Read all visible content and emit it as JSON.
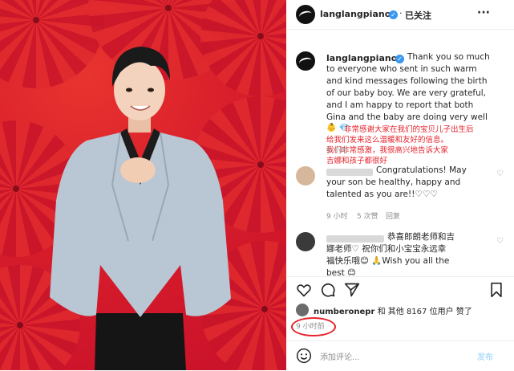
{
  "header": {
    "username": "langlangpiano",
    "follow_status": "已关注",
    "more": "···"
  },
  "caption": {
    "username": "langlangpiano",
    "lines": [
      "Thank you so much",
      "to everyone who sent in such warm",
      "and kind messages following the birth",
      "of our baby boy. We are very grateful,",
      "and I am happy to report that both",
      "Gina and the baby are doing very well"
    ],
    "emojis": "👶 💎",
    "translation": [
      "非常感谢大家在我们的宝贝儿子出生后",
      "给我们发来这么温暖和友好的信息。",
      "我们非常感激，我很高兴地告诉大家",
      "吉娜和孩子都很好"
    ],
    "time": "9 小时"
  },
  "comments": [
    {
      "lines": [
        "Congratulations! May",
        "your son be healthy, happy and",
        "talented as you are!!♡♡♡"
      ],
      "time": "9 小时",
      "likes": "5 次赞",
      "reply": "回复"
    },
    {
      "lines": [
        "恭喜郎朗老师和吉",
        "娜老师♡ 祝你们和小宝宝永远幸",
        "福快乐哦😊 🙏Wish you all the",
        "best 😊"
      ]
    }
  ],
  "likes": {
    "liker": "numberonepr",
    "rest": " 和 其他 8167 位用户 赞了"
  },
  "post_time": "9 小时前",
  "add_comment": {
    "placeholder": "添加评论...",
    "post": "发布"
  },
  "icons": {
    "like": "heart-icon",
    "comment": "comment-icon",
    "share": "paper-plane-icon",
    "save": "bookmark-icon",
    "emoji": "smiley-icon"
  }
}
